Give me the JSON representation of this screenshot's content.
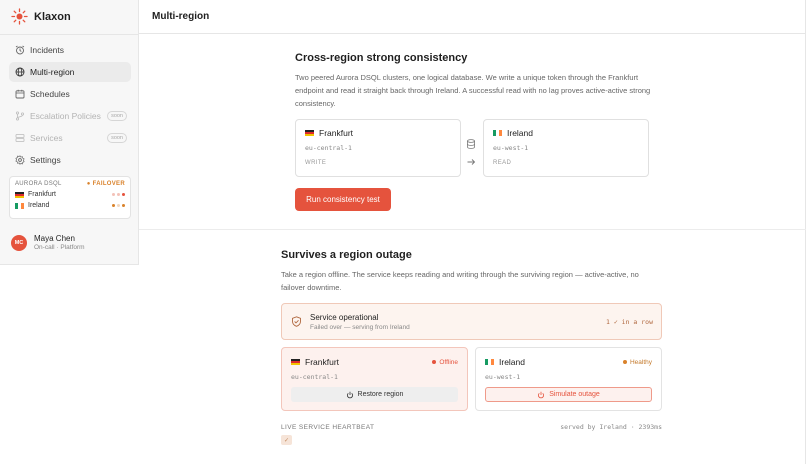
{
  "app": {
    "name": "Klaxon"
  },
  "sidebar": {
    "items": [
      {
        "label": "Incidents",
        "icon": "alarm-clock-icon",
        "state": "normal"
      },
      {
        "label": "Multi-region",
        "icon": "globe-icon",
        "state": "active"
      },
      {
        "label": "Schedules",
        "icon": "calendar-icon",
        "state": "normal"
      },
      {
        "label": "Escalation Policies",
        "icon": "branch-icon",
        "state": "disabled",
        "badge": "soon"
      },
      {
        "label": "Services",
        "icon": "server-icon",
        "state": "disabled",
        "badge": "soon"
      },
      {
        "label": "Settings",
        "icon": "gear-icon",
        "state": "normal"
      }
    ],
    "db_card": {
      "title": "AURORA DSQL",
      "status": "FAILOVER",
      "status_color": "#d9822b",
      "regions": [
        {
          "name": "Frankfurt",
          "flag": "de-flag"
        },
        {
          "name": "Ireland",
          "flag": "ie-flag"
        }
      ]
    },
    "user": {
      "initials": "MC",
      "name": "Maya Chen",
      "subtitle": "On-call · Platform"
    }
  },
  "header": {
    "title": "Multi-region"
  },
  "consistency": {
    "title": "Cross-region strong consistency",
    "description": "Two peered Aurora DSQL clusters, one logical database. We write a unique token through the Frankfurt endpoint and read it straight back through Ireland. A successful read with no lag proves active-active strong consistency.",
    "write_region": {
      "name": "Frankfurt",
      "code": "eu-central-1",
      "role": "WRITE"
    },
    "read_region": {
      "name": "Ireland",
      "code": "eu-west-1",
      "role": "READ"
    },
    "button_label": "Run consistency test"
  },
  "outage": {
    "title": "Survives a region outage",
    "description": "Take a region offline. The service keeps reading and writing through the surviving region — active-active, no failover downtime.",
    "status": {
      "title": "Service operational",
      "subtitle": "Failed over — serving from Ireland",
      "streak": "1 ✓ in a row"
    },
    "regions": [
      {
        "name": "Frankfurt",
        "code": "eu-central-1",
        "state": "Offline",
        "state_color": "#e5533d",
        "button": "Restore region"
      },
      {
        "name": "Ireland",
        "code": "eu-west-1",
        "state": "Healthy",
        "state_color": "#c47a2c",
        "button": "Simulate outage"
      }
    ],
    "heartbeat": {
      "label": "LIVE SERVICE HEARTBEAT",
      "served_by": "served by Ireland · 2393ms",
      "tick": "✓"
    }
  },
  "colors": {
    "accent": "#e5533d",
    "warning": "#d9822b"
  }
}
